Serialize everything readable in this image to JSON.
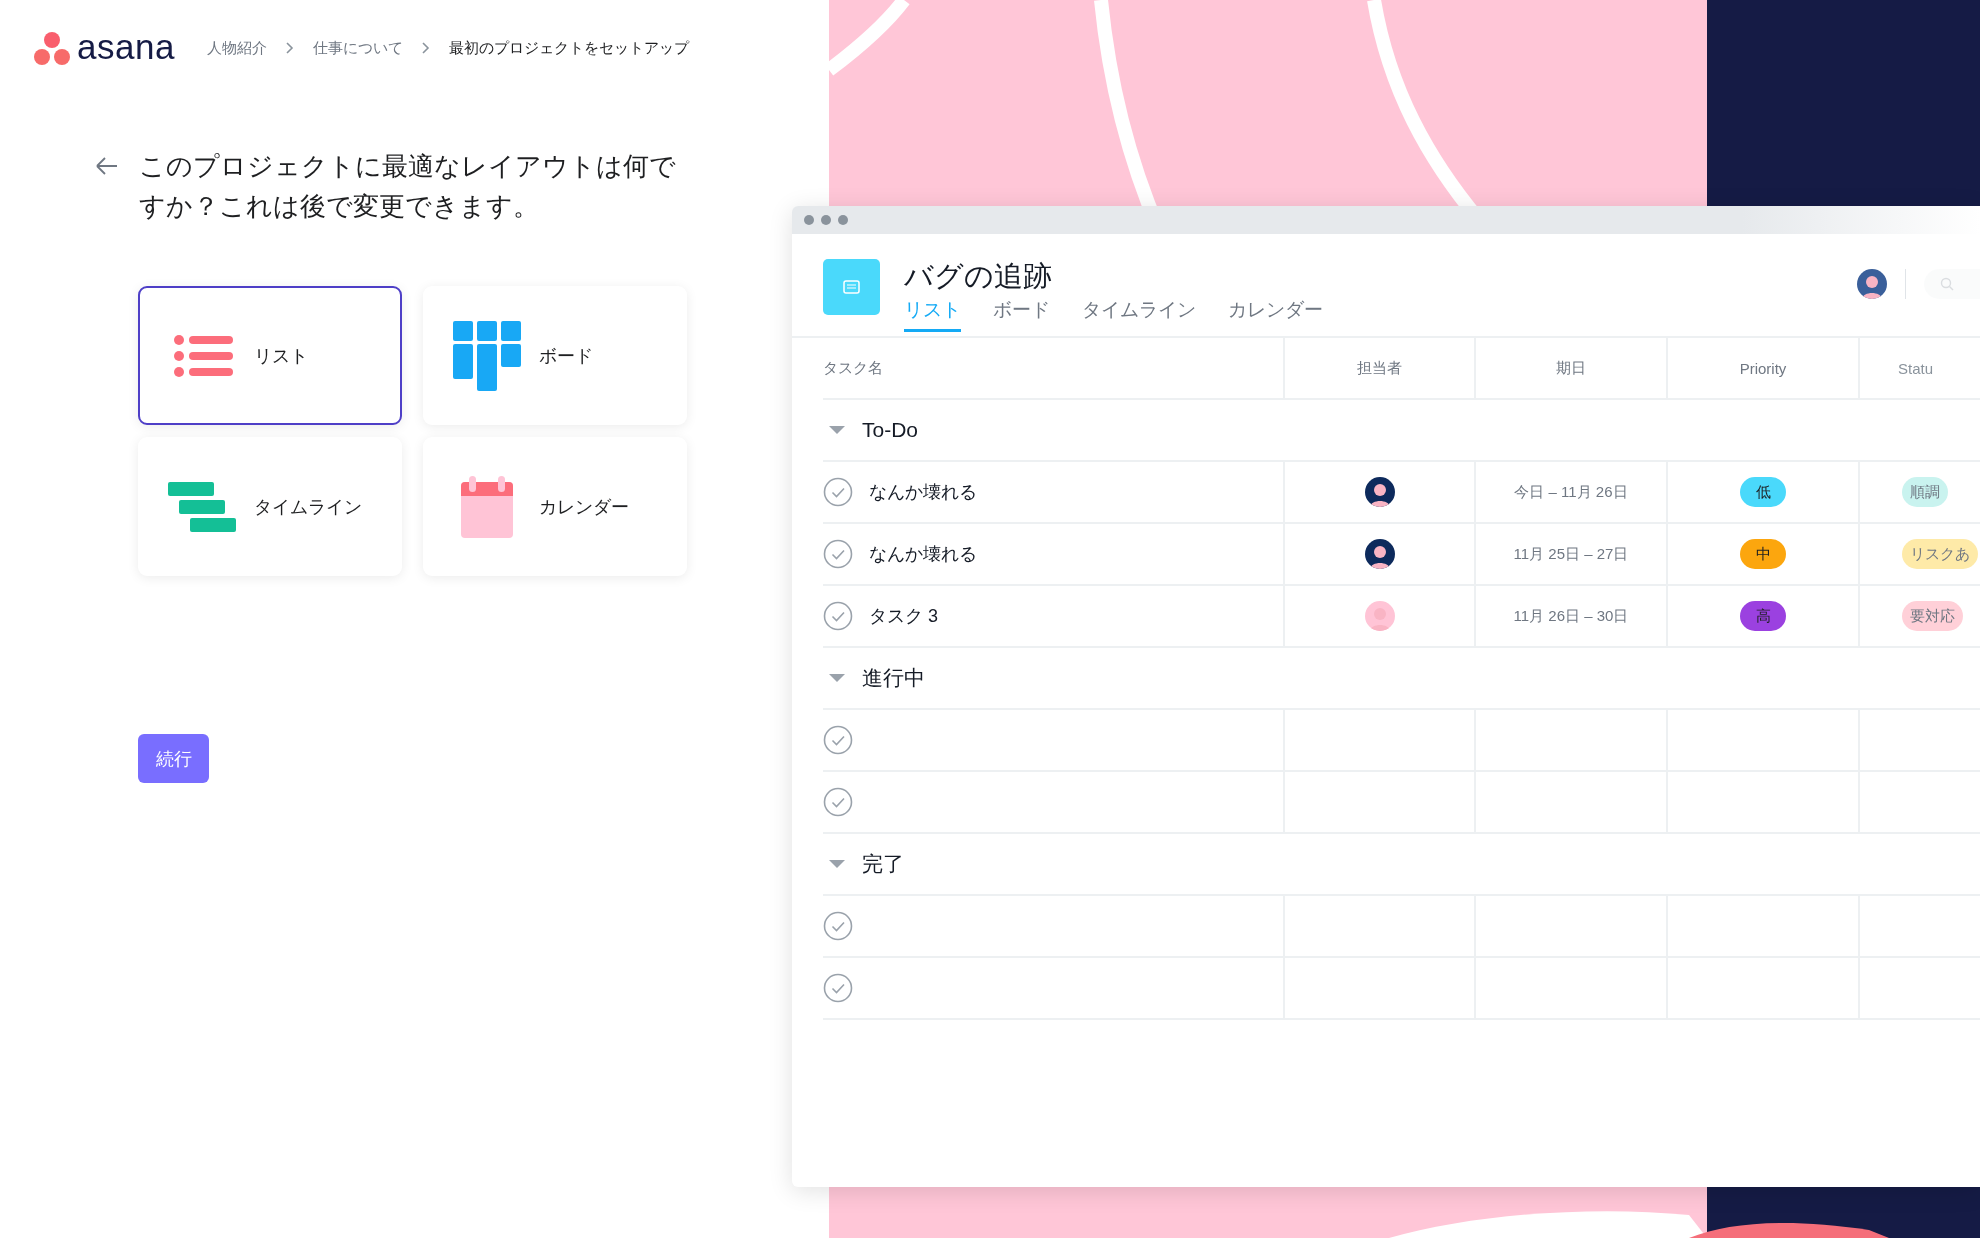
{
  "logo": {
    "text": "asana"
  },
  "breadcrumb": [
    {
      "label": "人物紹介",
      "current": false
    },
    {
      "label": "仕事について",
      "current": false
    },
    {
      "label": "最初のプロジェクトをセットアップ",
      "current": true
    }
  ],
  "question": "このプロジェクトに最適なレイアウトは何ですか？これは後で変更できます。",
  "layouts": [
    {
      "kind": "list",
      "label": "リスト",
      "selected": true
    },
    {
      "kind": "board",
      "label": "ボード",
      "selected": false
    },
    {
      "kind": "timeline",
      "label": "タイムライン",
      "selected": false
    },
    {
      "kind": "calendar",
      "label": "カレンダー",
      "selected": false
    }
  ],
  "continue_button": "続行",
  "project": {
    "title": "バグの追跡",
    "tabs": [
      {
        "label": "リスト",
        "selected": true
      },
      {
        "label": "ボード",
        "selected": false
      },
      {
        "label": "タイムライン",
        "selected": false
      },
      {
        "label": "カレンダー",
        "selected": false
      }
    ],
    "columns": [
      "タスク名",
      "担当者",
      "期日",
      "Priority",
      "Statu"
    ],
    "sections": [
      {
        "name": "To-Do",
        "expanded": true,
        "rows": [
          {
            "kind": "task",
            "task": "なんか壊れる",
            "avatar": {
              "color": "#0d2a5c"
            },
            "due": "今日 – 11月 26日",
            "priority": {
              "label": "低",
              "color": "#4ad9fb"
            },
            "status": {
              "label": "順調",
              "color": "#c9f3ef"
            }
          },
          {
            "kind": "task",
            "task": "なんか壊れる",
            "avatar": {
              "color": "#0d2a5c"
            },
            "due": "11月 25日 – 27日",
            "priority": {
              "label": "中",
              "color": "#fca60e"
            },
            "status": {
              "label": "リスクあ",
              "color": "#feeaa8"
            }
          },
          {
            "kind": "task",
            "task": "タスク 3",
            "avatar": {
              "color": "#ffc4d6"
            },
            "due": "11月 26日 – 30日",
            "priority": {
              "label": "高",
              "color": "#9b41e0"
            },
            "status": {
              "label": "要対応",
              "color": "#ffd0d8"
            }
          }
        ]
      },
      {
        "name": "進行中",
        "expanded": true,
        "rows": [
          {
            "kind": "blank"
          },
          {
            "kind": "blank"
          }
        ]
      },
      {
        "name": "完了",
        "expanded": true,
        "rows": [
          {
            "kind": "blank"
          },
          {
            "kind": "blank"
          }
        ]
      }
    ]
  }
}
